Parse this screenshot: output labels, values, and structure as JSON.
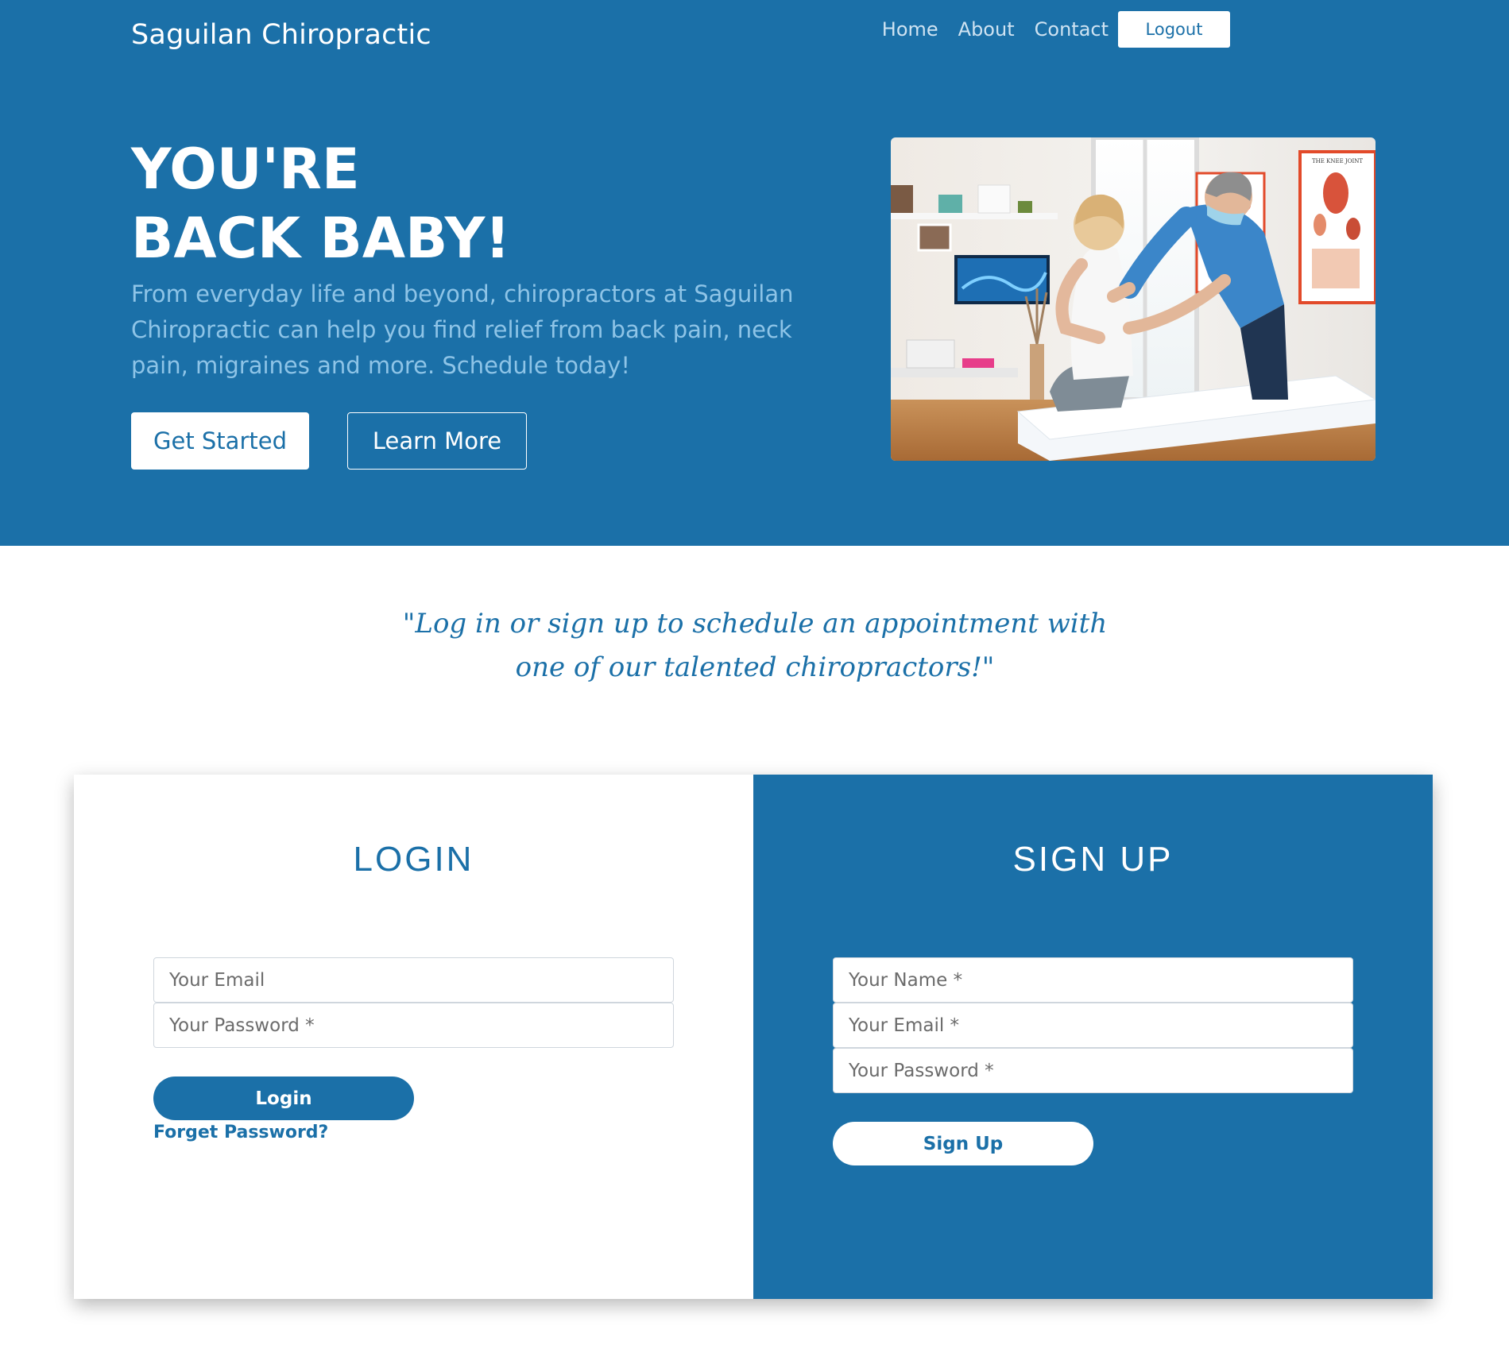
{
  "header": {
    "brand": "Saguilan Chiropractic",
    "nav": [
      "Home",
      "About",
      "Contact"
    ],
    "logout_label": "Logout"
  },
  "hero": {
    "headline_line1": "YOU'RE",
    "headline_line2": "BACK BABY!",
    "lead": "From everyday life and beyond, chiropractors at Saguilan Chiropractic can help you find relief from back pain, neck pain, migraines and more. Schedule today!",
    "primary_button": "Get Started",
    "secondary_button": "Learn More",
    "image_alt": "chiropractor examining patient's back",
    "poster_text": "THE KNEE JOINT"
  },
  "quote": {
    "line1": "\"Log in or sign up to schedule an appointment with",
    "line2": "one of our talented chiropractors!\""
  },
  "login": {
    "title": "LOGIN",
    "email_placeholder": "Your Email",
    "password_placeholder": "Your Password *",
    "submit_label": "Login",
    "forgot_label": "Forget Password?"
  },
  "signup": {
    "title": "SIGN UP",
    "name_placeholder": "Your Name *",
    "email_placeholder": "Your Email *",
    "password_placeholder": "Your Password *",
    "submit_label": "Sign Up"
  },
  "colors": {
    "brand_blue": "#1b70a8",
    "lead_text": "#8ec4e7",
    "white": "#ffffff"
  }
}
